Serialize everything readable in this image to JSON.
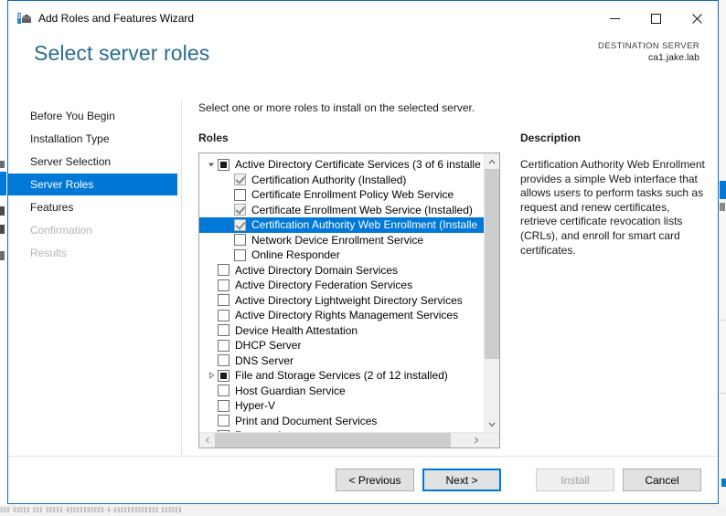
{
  "window": {
    "title": "Add Roles and Features Wizard",
    "icon": "wizard-toolbox-icon",
    "minimize_label": "–",
    "maximize_label": "□",
    "close_label": "✕"
  },
  "header": {
    "page_title": "Select server roles",
    "destination_label": "DESTINATION SERVER",
    "destination_value": "ca1.jake.lab"
  },
  "nav": {
    "items": [
      {
        "label": "Before You Begin",
        "state": "normal"
      },
      {
        "label": "Installation Type",
        "state": "normal"
      },
      {
        "label": "Server Selection",
        "state": "normal"
      },
      {
        "label": "Server Roles",
        "state": "active"
      },
      {
        "label": "Features",
        "state": "normal"
      },
      {
        "label": "Confirmation",
        "state": "disabled"
      },
      {
        "label": "Results",
        "state": "disabled"
      }
    ]
  },
  "main": {
    "instruction": "Select one or more roles to install on the selected server.",
    "roles_label": "Roles",
    "roles": [
      {
        "label": "Active Directory Certificate Services (3 of 6 installe",
        "level": 0,
        "expander": "expanded",
        "check": "partial",
        "selected": false
      },
      {
        "label": "Certification Authority (Installed)",
        "level": 1,
        "expander": "none",
        "check": "checked-disabled",
        "selected": false
      },
      {
        "label": "Certificate Enrollment Policy Web Service",
        "level": 1,
        "expander": "none",
        "check": "unchecked",
        "selected": false
      },
      {
        "label": "Certificate Enrollment Web Service (Installed)",
        "level": 1,
        "expander": "none",
        "check": "checked-disabled",
        "selected": false
      },
      {
        "label": "Certification Authority Web Enrollment (Installe",
        "level": 1,
        "expander": "none",
        "check": "checked-disabled",
        "selected": true
      },
      {
        "label": "Network Device Enrollment Service",
        "level": 1,
        "expander": "none",
        "check": "unchecked",
        "selected": false
      },
      {
        "label": "Online Responder",
        "level": 1,
        "expander": "none",
        "check": "unchecked",
        "selected": false
      },
      {
        "label": "Active Directory Domain Services",
        "level": 0,
        "expander": "none",
        "check": "unchecked",
        "selected": false
      },
      {
        "label": "Active Directory Federation Services",
        "level": 0,
        "expander": "none",
        "check": "unchecked",
        "selected": false
      },
      {
        "label": "Active Directory Lightweight Directory Services",
        "level": 0,
        "expander": "none",
        "check": "unchecked",
        "selected": false
      },
      {
        "label": "Active Directory Rights Management Services",
        "level": 0,
        "expander": "none",
        "check": "unchecked",
        "selected": false
      },
      {
        "label": "Device Health Attestation",
        "level": 0,
        "expander": "none",
        "check": "unchecked",
        "selected": false
      },
      {
        "label": "DHCP Server",
        "level": 0,
        "expander": "none",
        "check": "unchecked",
        "selected": false
      },
      {
        "label": "DNS Server",
        "level": 0,
        "expander": "none",
        "check": "unchecked",
        "selected": false
      },
      {
        "label": "File and Storage Services (2 of 12 installed)",
        "level": 0,
        "expander": "collapsed",
        "check": "partial",
        "selected": false
      },
      {
        "label": "Host Guardian Service",
        "level": 0,
        "expander": "none",
        "check": "unchecked",
        "selected": false
      },
      {
        "label": "Hyper-V",
        "level": 0,
        "expander": "none",
        "check": "unchecked",
        "selected": false
      },
      {
        "label": "Print and Document Services",
        "level": 0,
        "expander": "none",
        "check": "unchecked",
        "selected": false
      },
      {
        "label": "Remote Access",
        "level": 0,
        "expander": "none",
        "check": "unchecked",
        "selected": false
      }
    ],
    "scrollbar": {
      "up_arrow": "⌃",
      "down_arrow": "⌄",
      "left_arrow": "‹",
      "right_arrow": "›"
    }
  },
  "description": {
    "title": "Description",
    "text": "Certification Authority Web Enrollment provides a simple Web interface that allows users to perform tasks such as request and renew certificates, retrieve certificate revocation lists (CRLs), and enroll for smart card certificates."
  },
  "footer": {
    "previous_label": "< Previous",
    "next_label": "Next >",
    "install_label": "Install",
    "cancel_label": "Cancel"
  },
  "colors": {
    "accent": "#0078d7",
    "title_teal": "#2a6c8f",
    "window_border": "#0f6cbd"
  },
  "background": {
    "noise_text": "‖‖‖  ‖‖‖‖‖  ‖‖‖ ‖‖‖‖‖-‖‖‖‖‖‖‖‖‖‖‖-‖-‖‖‖‖‖‖‖‖‖‖‖‖‖           ‖‖‖‖‖‖"
  }
}
